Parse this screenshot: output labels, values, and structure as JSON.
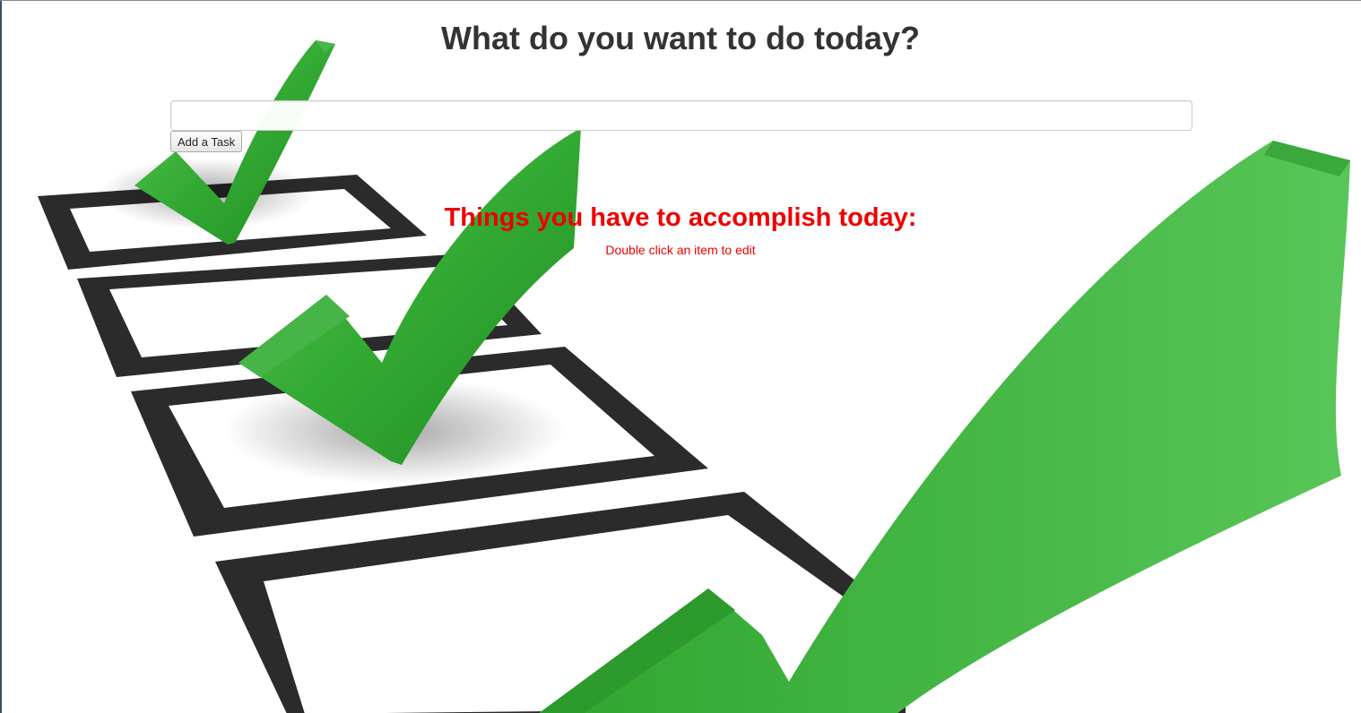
{
  "header": {
    "title": "What do you want to do today?"
  },
  "task_form": {
    "input_value": "",
    "input_placeholder": "",
    "add_button_label": "Add a Task"
  },
  "task_list": {
    "heading": "Things you have to accomplish today:",
    "hint": "Double click an item to edit",
    "items": []
  },
  "background": {
    "icon": "checklist-checkmarks-illustration"
  },
  "colors": {
    "title_text": "#333333",
    "accent_red": "#ee0000",
    "check_green": "#3cb043",
    "box_frame": "#2b2b2b"
  }
}
